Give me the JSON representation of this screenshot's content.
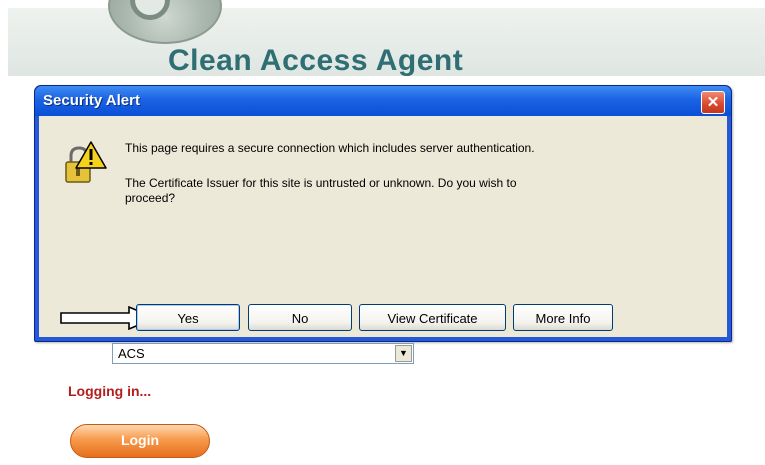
{
  "app": {
    "title": "Clean Access Agent"
  },
  "dialog": {
    "title": "Security Alert",
    "close_label": "✕",
    "message_line_1": "This page requires a secure connection which includes server authentication.",
    "message_line_2": "The Certificate Issuer for this site is untrusted or unknown.  Do you wish to proceed?",
    "buttons": {
      "yes": "Yes",
      "no": "No",
      "view_certificate": "View Certificate",
      "more_info": "More Info"
    }
  },
  "form": {
    "server_select_value": "ACS",
    "status_text": "Logging in...",
    "login_label": "Login"
  },
  "colors": {
    "title_teal": "#2f6f73",
    "dialog_blue": "#2559d8",
    "status_red": "#b41e1e",
    "login_orange": "#f79a4c"
  },
  "icons": {
    "dialog_icon": "warning-lock-icon",
    "pointer": "arrow-right-icon",
    "dropdown": "chevron-down-icon"
  }
}
